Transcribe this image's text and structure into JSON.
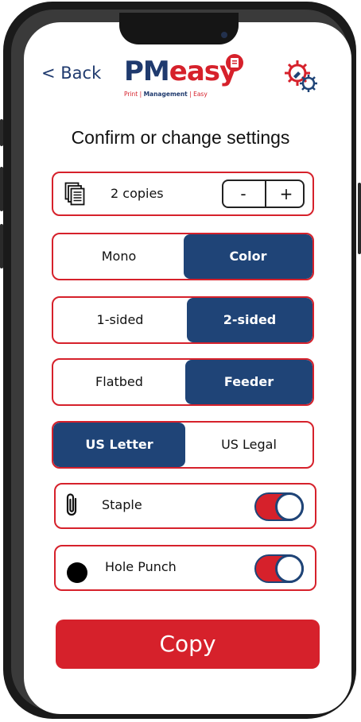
{
  "header": {
    "back_label": "< Back",
    "logo_pm": "PM",
    "logo_easy": "easy",
    "logo_tagline_print": "Print",
    "logo_tagline_management": "Management",
    "logo_tagline_easy": "Easy",
    "logo_tagline_sep": " | ",
    "settings_icon": "gear-icon"
  },
  "title": "Confirm or change settings",
  "copies": {
    "icon": "copies-icon",
    "label": "2 copies",
    "minus_label": "-",
    "plus_label": "+"
  },
  "color_mode": {
    "options": [
      "Mono",
      "Color"
    ],
    "selected": "Color"
  },
  "sides": {
    "options": [
      "1-sided",
      "2-sided"
    ],
    "selected": "2-sided"
  },
  "source": {
    "options": [
      "Flatbed",
      "Feeder"
    ],
    "selected": "Feeder"
  },
  "paper": {
    "options": [
      "US Letter",
      "US Legal"
    ],
    "selected": "US Letter"
  },
  "staple": {
    "label": "Staple",
    "icon": "paperclip-icon",
    "on": true
  },
  "hole_punch": {
    "label": "Hole Punch",
    "icon": "dot-icon",
    "on": true
  },
  "copy_button": {
    "label": "Copy"
  },
  "colors": {
    "brand_blue": "#1f4477",
    "brand_red": "#d6212b"
  }
}
